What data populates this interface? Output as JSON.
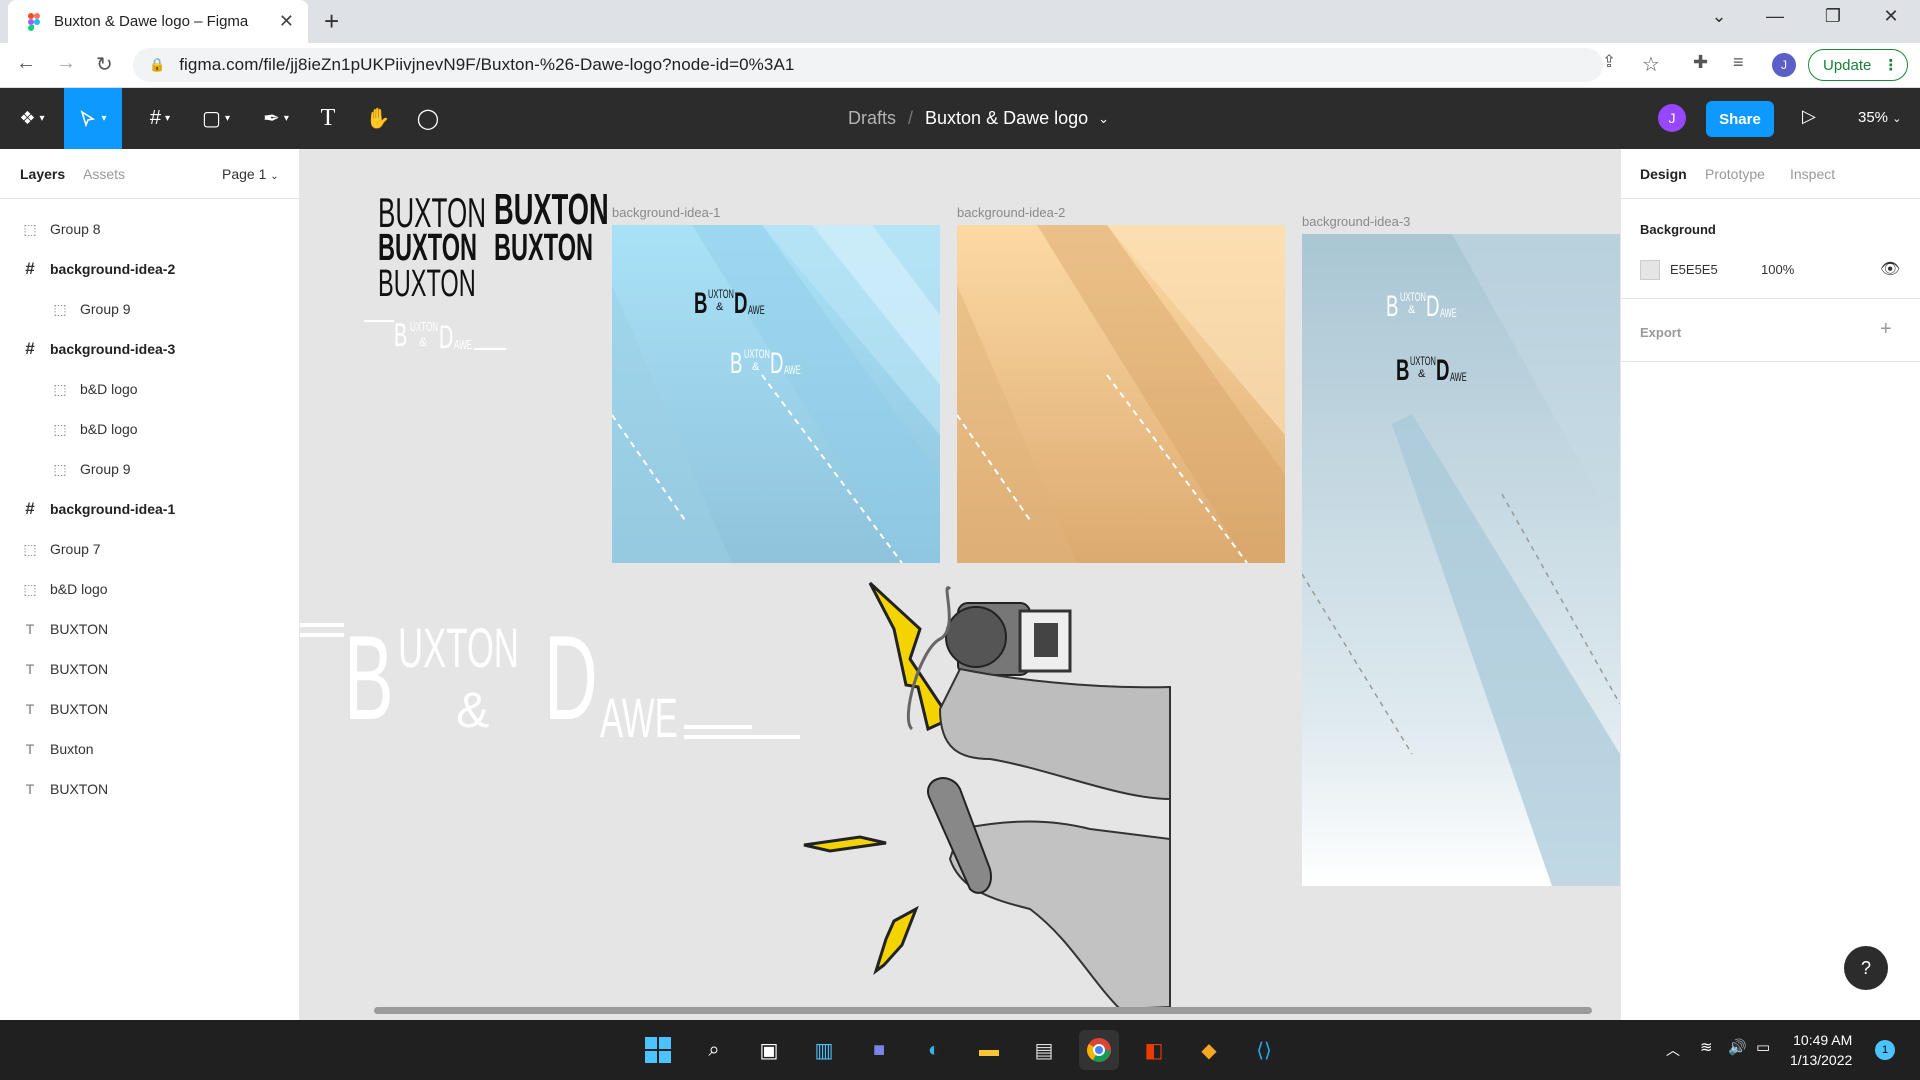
{
  "browser": {
    "tab_title": "Buxton & Dawe logo – Figma",
    "url": "figma.com/file/jj8ieZn1pUKPiivjnevN9F/Buxton-%26-Dawe-logo?node-id=0%3A1",
    "update_label": "Update",
    "profile_initial": "J"
  },
  "toolbar": {
    "breadcrumb_drafts": "Drafts",
    "breadcrumb_sep": "/",
    "file_name": "Buxton & Dawe logo",
    "avatar_initial": "J",
    "share_label": "Share",
    "zoom": "35%"
  },
  "left_panel": {
    "tab_layers": "Layers",
    "tab_assets": "Assets",
    "page_select": "Page 1",
    "layers": [
      {
        "label": "Group 8",
        "type": "group",
        "indent": 0
      },
      {
        "label": "background-idea-2",
        "type": "frame",
        "indent": 0
      },
      {
        "label": "Group 9",
        "type": "group",
        "indent": 1
      },
      {
        "label": "background-idea-3",
        "type": "frame",
        "indent": 0
      },
      {
        "label": "b&D logo",
        "type": "group",
        "indent": 1
      },
      {
        "label": "b&D logo",
        "type": "group",
        "indent": 1
      },
      {
        "label": "Group 9",
        "type": "group",
        "indent": 1
      },
      {
        "label": "background-idea-1",
        "type": "frame",
        "indent": 0
      },
      {
        "label": "Group 7",
        "type": "group",
        "indent": 0
      },
      {
        "label": "b&D logo",
        "type": "group",
        "indent": 0
      },
      {
        "label": "BUXTON",
        "type": "text",
        "indent": 0
      },
      {
        "label": "BUXTON",
        "type": "text",
        "indent": 0
      },
      {
        "label": "BUXTON",
        "type": "text",
        "indent": 0
      },
      {
        "label": "Buxton",
        "type": "text",
        "indent": 0
      },
      {
        "label": "BUXTON",
        "type": "text",
        "indent": 0
      }
    ]
  },
  "canvas": {
    "frames": [
      {
        "label": "background-idea-1"
      },
      {
        "label": "background-idea-2"
      },
      {
        "label": "background-idea-3"
      }
    ],
    "buxton_samples": [
      "BUXTON",
      "BUXTON",
      "BUXTON",
      "BUXTON",
      "BUXTON"
    ],
    "logo": {
      "b": "B",
      "uxton": "UXTON",
      "amp": "&",
      "d": "D",
      "awe": "AWE"
    }
  },
  "right_panel": {
    "tab_design": "Design",
    "tab_prototype": "Prototype",
    "tab_inspect": "Inspect",
    "background_heading": "Background",
    "background_hex": "E5E5E5",
    "background_opacity": "100%",
    "export_heading": "Export",
    "background_color": "#e5e5e5"
  },
  "help_label": "?",
  "taskbar": {
    "time": "10:49 AM",
    "date": "1/13/2022",
    "notification_count": "1"
  }
}
